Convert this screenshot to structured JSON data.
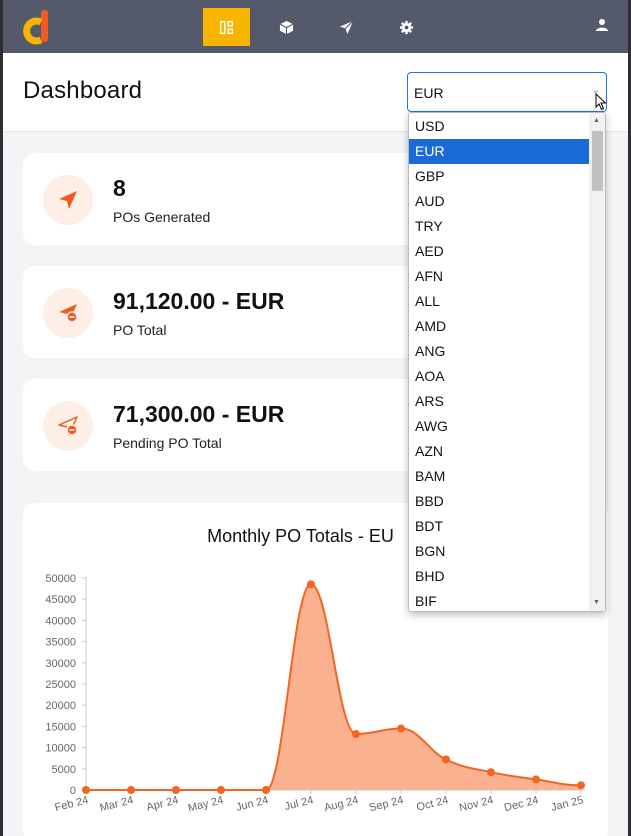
{
  "nav": {
    "items": [
      {
        "name": "dashboard-icon",
        "active": true
      },
      {
        "name": "box-icon",
        "active": false
      },
      {
        "name": "send-icon",
        "active": false
      },
      {
        "name": "gear-icon",
        "active": false
      }
    ],
    "user_icon": "user-icon"
  },
  "header": {
    "title": "Dashboard",
    "currency_selected": "EUR"
  },
  "cards": [
    {
      "value": "8",
      "label": "POs Generated",
      "icon": "paper-plane-icon"
    },
    {
      "value": "91,120.00 - EUR",
      "label": "PO Total",
      "icon": "paper-plane-minus-icon"
    },
    {
      "value": "71,300.00 - EUR",
      "label": "Pending PO Total",
      "icon": "paper-plane-outline-minus-icon"
    }
  ],
  "dropdown": {
    "options": [
      "USD",
      "EUR",
      "GBP",
      "AUD",
      "TRY",
      "AED",
      "AFN",
      "ALL",
      "AMD",
      "ANG",
      "AOA",
      "ARS",
      "AWG",
      "AZN",
      "BAM",
      "BBD",
      "BDT",
      "BGN",
      "BHD",
      "BIF"
    ],
    "selected": "EUR"
  },
  "colors": {
    "nav_bg": "#545a6b",
    "accent": "#f7b500",
    "brand_orange": "#f15a22",
    "series_line": "#f26522",
    "series_fill": "#f9b18f",
    "selected_bg": "#1a6bd6"
  },
  "chart_data": {
    "type": "area",
    "title": "Monthly PO Totals - EU",
    "categories": [
      "Feb 24",
      "Mar 24",
      "Apr 24",
      "May 24",
      "Jun 24",
      "Jul 24",
      "Aug 24",
      "Sep 24",
      "Oct 24",
      "Nov 24",
      "Dec 24",
      "Jan 25"
    ],
    "series": [
      {
        "values": [
          0,
          0,
          0,
          0,
          0,
          48500,
          13200,
          14500,
          7200,
          4200,
          2500,
          1100
        ]
      }
    ],
    "yticks": [
      0,
      5000,
      10000,
      15000,
      20000,
      25000,
      30000,
      35000,
      40000,
      45000,
      50000
    ],
    "ylim": [
      0,
      50000
    ],
    "grid": false
  }
}
